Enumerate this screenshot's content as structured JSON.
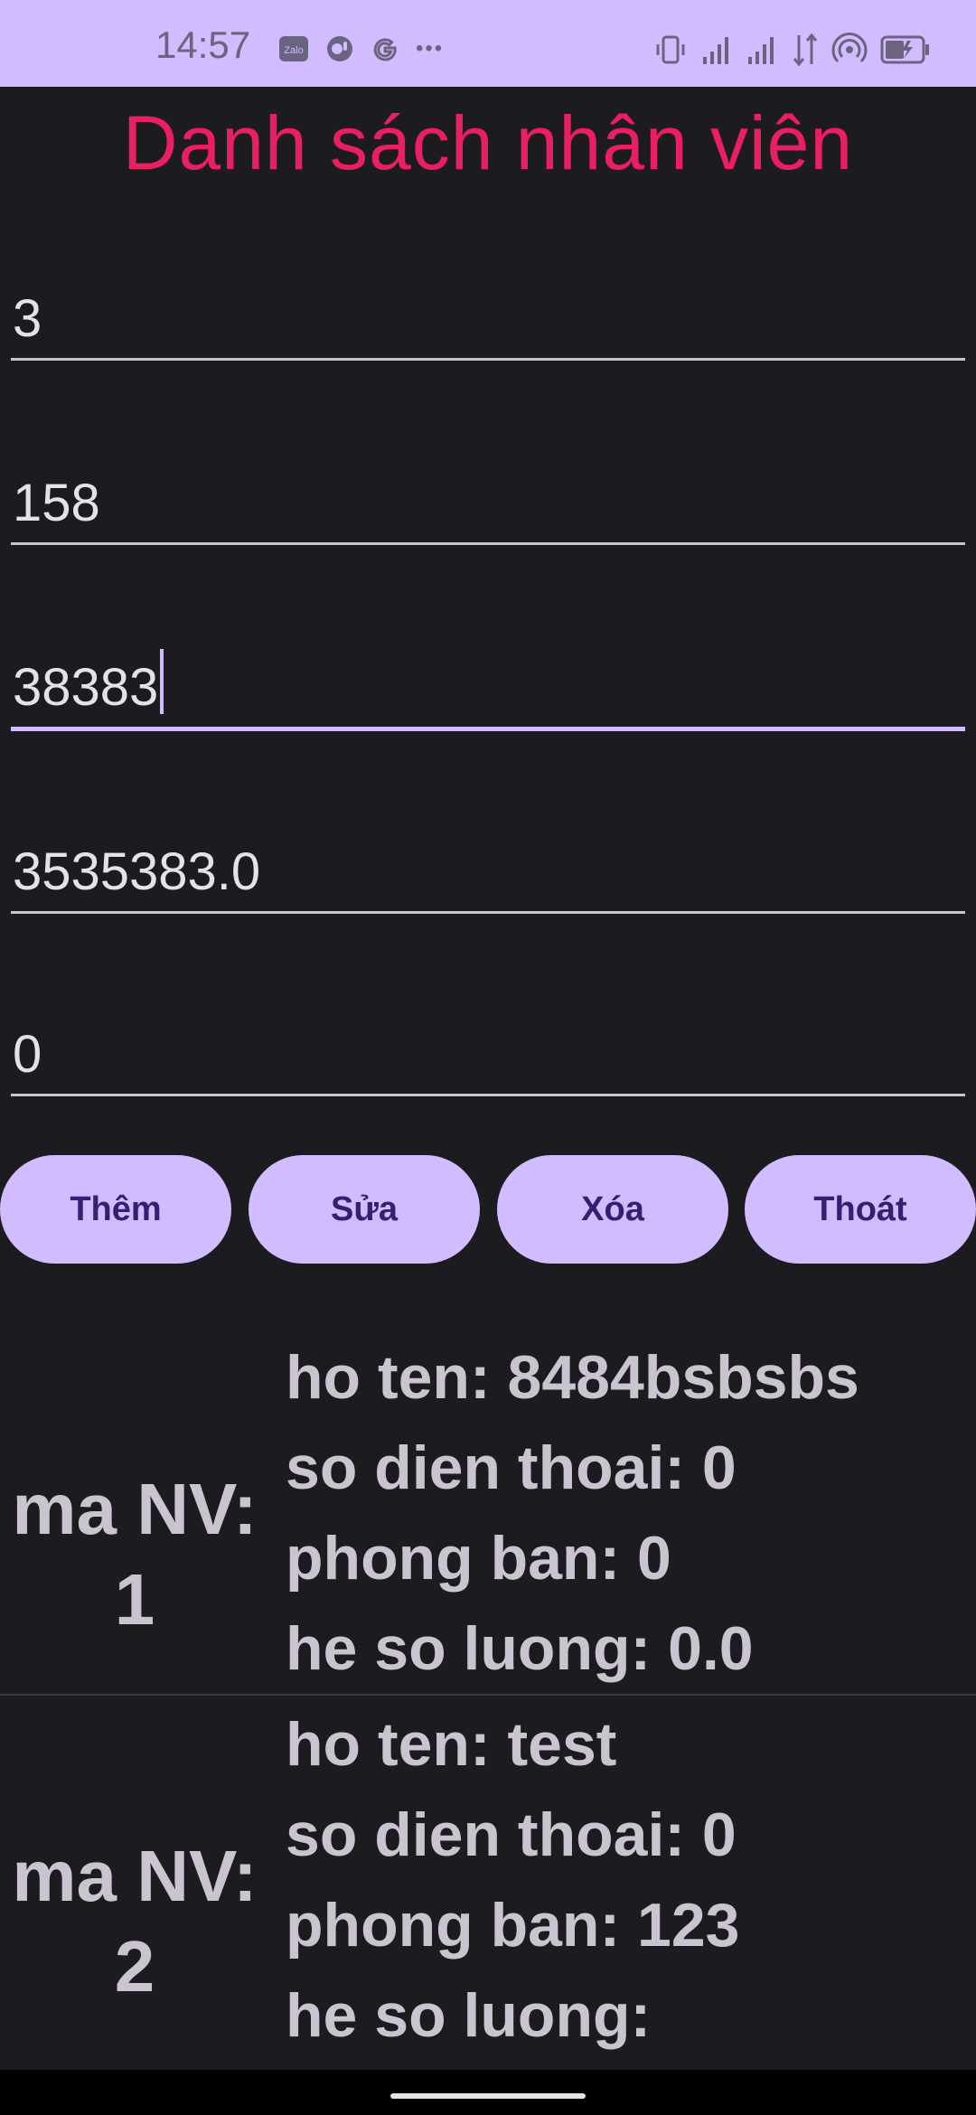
{
  "status_bar": {
    "time": "14:57",
    "left_icons": [
      "zalo-icon",
      "chat-icon",
      "google-icon",
      "more-dots-icon"
    ],
    "right_icons": [
      "vibrate-icon",
      "signal-icon",
      "signal-icon",
      "data-arrows-icon",
      "hotspot-icon",
      "battery-charging-icon"
    ],
    "zalo_text": "Zalo",
    "more_dots": "•••"
  },
  "header": {
    "title": "Danh sách nhân viên"
  },
  "form": {
    "field1": "3",
    "field2": "158",
    "field3": "38383",
    "field4": "3535383.0",
    "field5": "0"
  },
  "actions": {
    "add_label": "Thêm",
    "edit_label": "Sửa",
    "delete_label": "Xóa",
    "exit_label": "Thoát"
  },
  "employees": [
    {
      "ma_label": "ma NV:",
      "ma": "1",
      "ho_ten": "ho ten: 8484bsbsbs",
      "so_dien_thoai": "so dien thoai: 0",
      "phong_ban": "phong ban: 0",
      "he_so_luong": "he so luong: 0.0"
    },
    {
      "ma_label": "ma NV:",
      "ma": "2",
      "ho_ten": "ho ten: test",
      "so_dien_thoai": "so dien thoai: 0",
      "phong_ban": "phong ban: 123",
      "he_so_luong": "he so luong:"
    }
  ],
  "colors": {
    "status_bar_bg": "#d0bcff",
    "background": "#1c1b1f",
    "title": "#e91e63",
    "button_bg": "#d0bcff",
    "button_text": "#381e72",
    "text": "#cac4d0"
  }
}
